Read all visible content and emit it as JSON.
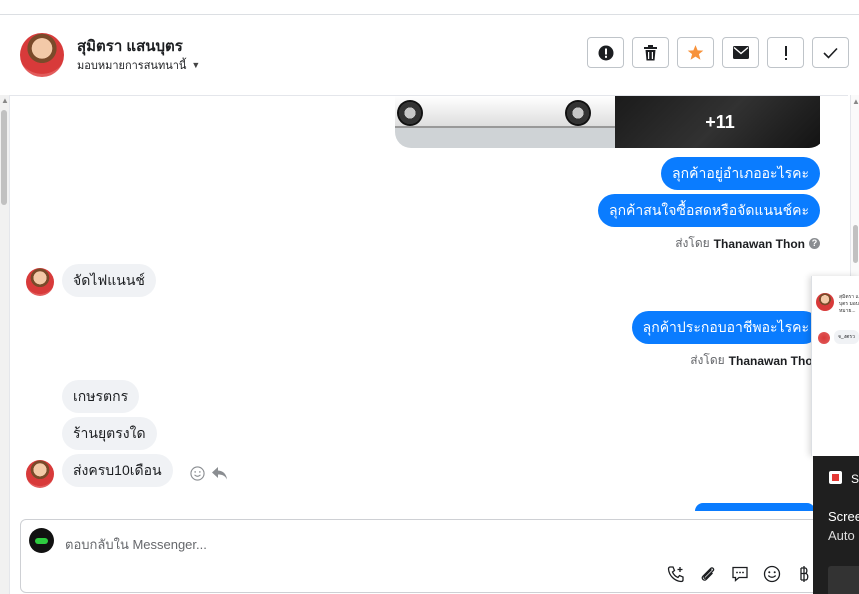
{
  "header": {
    "contact_name": "สุมิตรา แสนบุตร",
    "assign_label": "มอบหมายการสนทนานี้",
    "actions": [
      {
        "name": "report-button",
        "icon": "exclamation-circle-icon"
      },
      {
        "name": "delete-button",
        "icon": "trash-icon"
      },
      {
        "name": "star-button",
        "icon": "star-icon"
      },
      {
        "name": "mark-unread-button",
        "icon": "envelope-icon"
      },
      {
        "name": "important-button",
        "icon": "exclamation-icon"
      },
      {
        "name": "done-button",
        "icon": "checkmark-icon"
      }
    ]
  },
  "thread": {
    "photo_more": "+11",
    "outgoing_1": "ลุกค้าอยู่อำเภออะไรคะ",
    "outgoing_2": "ลุกค้าสนใจซื้อสดหรือจัดแนนช์คะ",
    "sent_by_prefix": "ส่งโดย",
    "sent_by_name_1": "Thanawan Thon",
    "incoming_1": "จัดไฟแนนช์",
    "outgoing_3": "ลุกค้าประกอบอาชีพอะไรคะ",
    "sent_by_name_2": "Thanawan Thon",
    "incoming_2": "เกษรตกร",
    "incoming_3": "ร้านยุตรงใด",
    "incoming_4": "ส่งครบ10เดือน"
  },
  "composer": {
    "placeholder": "ตอบกลับใน Messenger..."
  },
  "popup": {
    "preview_text": "สุมิตรา แสนบุตร มอบหมาย...",
    "preview_msg": "จ_งตรว"
  },
  "toast": {
    "letter": "S",
    "line1": "Scree",
    "line2": "Auto"
  },
  "colors": {
    "accent": "#0a7cff",
    "star": "#f7923b",
    "incoming_bubble": "#f0f2f5"
  }
}
